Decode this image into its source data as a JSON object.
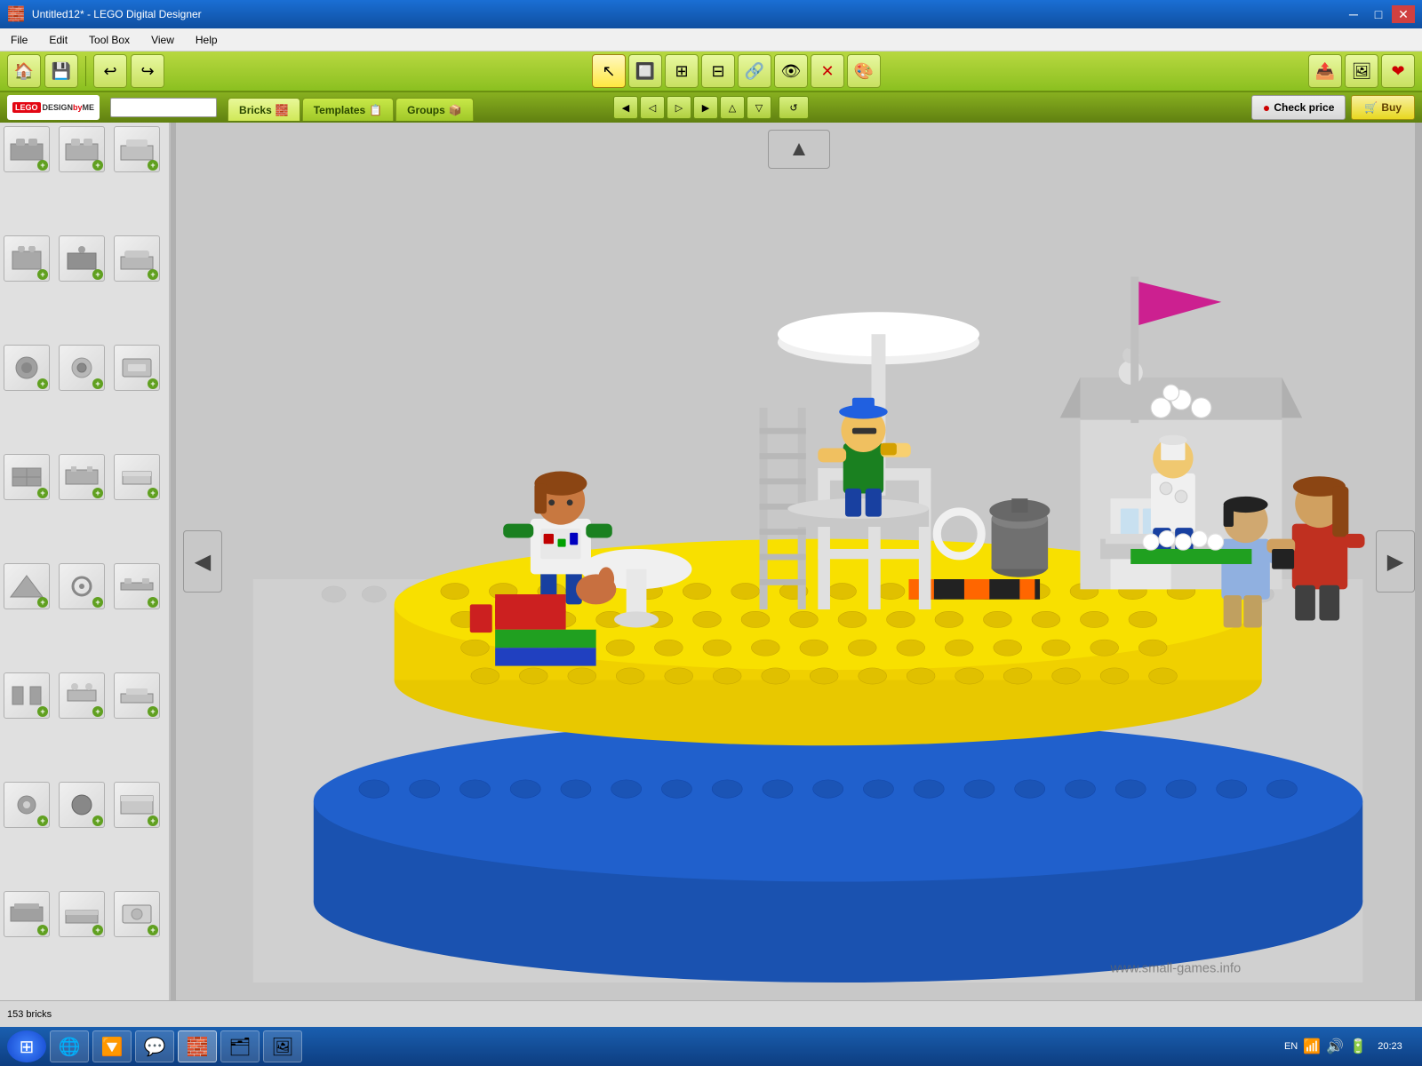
{
  "window": {
    "title": "Untitled12* - LEGO Digital Designer",
    "minimize": "─",
    "maximize": "□",
    "close": "✕"
  },
  "menu": {
    "items": [
      "File",
      "Edit",
      "Tool Box",
      "View",
      "Help"
    ]
  },
  "toolbar": {
    "buttons": [
      {
        "icon": "🏠",
        "name": "home"
      },
      {
        "icon": "💾",
        "name": "save"
      },
      {
        "icon": "↩",
        "name": "undo"
      },
      {
        "icon": "↪",
        "name": "redo"
      }
    ]
  },
  "action_toolbar": {
    "buttons": [
      {
        "icon": "↖",
        "name": "select",
        "active": true
      },
      {
        "icon": "🧱",
        "name": "brick1"
      },
      {
        "icon": "⊞",
        "name": "brick2"
      },
      {
        "icon": "⊟",
        "name": "brick3"
      },
      {
        "icon": "✂",
        "name": "cut"
      },
      {
        "icon": "🔗",
        "name": "connect"
      },
      {
        "icon": "👁",
        "name": "view"
      },
      {
        "icon": "✕",
        "name": "delete"
      },
      {
        "icon": "🎨",
        "name": "paint"
      }
    ],
    "nav_buttons": [
      {
        "icon": "◀",
        "name": "nav1"
      },
      {
        "icon": "◁",
        "name": "nav2"
      },
      {
        "icon": "▷",
        "name": "nav3"
      },
      {
        "icon": "▶",
        "name": "nav4"
      },
      {
        "icon": "△",
        "name": "nav5"
      },
      {
        "icon": "▽",
        "name": "nav6"
      },
      {
        "icon": "↺",
        "name": "nav7"
      }
    ]
  },
  "tabs": {
    "items": [
      {
        "label": "Bricks",
        "active": true,
        "icon": "🧱"
      },
      {
        "label": "Templates",
        "active": false,
        "icon": "📋"
      },
      {
        "label": "Groups",
        "active": false,
        "icon": "📦"
      }
    ]
  },
  "top_right": {
    "check_price_label": "Check price",
    "buy_label": "Buy",
    "check_icon": "🔴",
    "buy_icon": "🛒"
  },
  "left_panel": {
    "search_placeholder": "",
    "bricks": [
      {
        "icon": "⬜",
        "id": "b1"
      },
      {
        "icon": "▭",
        "id": "b2"
      },
      {
        "icon": "◧",
        "id": "b3"
      },
      {
        "icon": "⬛",
        "id": "b4"
      },
      {
        "icon": "▪",
        "id": "b5"
      },
      {
        "icon": "◫",
        "id": "b6"
      },
      {
        "icon": "◎",
        "id": "b7"
      },
      {
        "icon": "◉",
        "id": "b8"
      },
      {
        "icon": "◈",
        "id": "b9"
      },
      {
        "icon": "▣",
        "id": "b10"
      },
      {
        "icon": "▤",
        "id": "b11"
      },
      {
        "icon": "▥",
        "id": "b12"
      },
      {
        "icon": "▦",
        "id": "b13"
      },
      {
        "icon": "▧",
        "id": "b14"
      },
      {
        "icon": "▨",
        "id": "b15"
      },
      {
        "icon": "☰",
        "id": "b16"
      },
      {
        "icon": "◎",
        "id": "b17"
      },
      {
        "icon": "▬",
        "id": "b18"
      },
      {
        "icon": "○",
        "id": "b19"
      },
      {
        "icon": "●",
        "id": "b20"
      },
      {
        "icon": "▭",
        "id": "b21"
      },
      {
        "icon": "⊡",
        "id": "b22"
      },
      {
        "icon": "⊟",
        "id": "b23"
      },
      {
        "icon": "◎",
        "id": "b24"
      }
    ]
  },
  "status_bar": {
    "brick_count": "153 bricks"
  },
  "taskbar": {
    "time": "20:23",
    "language": "EN",
    "apps": [
      {
        "icon": "🌐",
        "name": "chrome"
      },
      {
        "icon": "🔽",
        "name": "torrent"
      },
      {
        "icon": "💬",
        "name": "skype"
      },
      {
        "icon": "💻",
        "name": "app"
      },
      {
        "icon": "🗂",
        "name": "explorer"
      },
      {
        "icon": "🖼",
        "name": "media"
      }
    ]
  },
  "watermark": "www.small-games.info",
  "colors": {
    "title_bar_top": "#1a6fd4",
    "title_bar_bottom": "#0f4fa0",
    "toolbar_green_top": "#b8d840",
    "toolbar_green_bottom": "#8bc020",
    "tab_bar": "#6a9010",
    "canvas_bg": "#c8c8c8",
    "left_panel_bg": "#e8e8e8"
  }
}
